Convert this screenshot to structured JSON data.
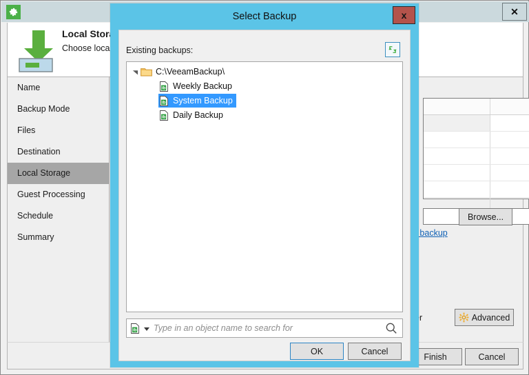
{
  "wizard": {
    "app_icon": "gear-icon",
    "close_label": "✕",
    "header": {
      "title": "Local Storage",
      "subtitle": "Choose locall",
      "icon": "down-arrow-icon"
    },
    "nav": {
      "items": [
        {
          "label": "Name",
          "selected": false
        },
        {
          "label": "Backup Mode",
          "selected": false
        },
        {
          "label": "Files",
          "selected": false
        },
        {
          "label": "Destination",
          "selected": false
        },
        {
          "label": "Local Storage",
          "selected": true
        },
        {
          "label": "Guest Processing",
          "selected": false
        },
        {
          "label": "Schedule",
          "selected": false
        },
        {
          "label": "Summary",
          "selected": false
        }
      ]
    },
    "content": {
      "refresh_icon": "refresh-icon",
      "browse_label": "Browse...",
      "map_backup_link": "p backup",
      "advanced_prefix_text": "er",
      "advanced_label": "Advanced",
      "advanced_icon": "gear-icon",
      "grid_rows": 7
    },
    "footer": {
      "finish_label": "Finish",
      "cancel_label": "Cancel"
    }
  },
  "dialog": {
    "title": "Select Backup",
    "close_label": "x",
    "existing_label": "Existing backups:",
    "refresh_icon": "refresh-icon",
    "tree": {
      "root": {
        "label": "C:\\VeeamBackup\\",
        "icon": "folder-icon",
        "expanded": true
      },
      "children": [
        {
          "label": "Weekly Backup",
          "icon": "backup-file-icon",
          "selected": false
        },
        {
          "label": "System Backup",
          "icon": "backup-file-icon",
          "selected": true
        },
        {
          "label": "Daily Backup",
          "icon": "backup-file-icon",
          "selected": false
        }
      ]
    },
    "search": {
      "placeholder": "Type in an object name to search for",
      "value": "",
      "type_icon": "backup-file-icon",
      "search_icon": "magnifier-icon"
    },
    "ok_label": "OK",
    "cancel_label": "Cancel"
  },
  "colors": {
    "dialog_border": "#5bc4e7",
    "selection": "#3399ff",
    "accent_green": "#4bb048",
    "close_red": "#b4534b",
    "link_blue": "#1061b5",
    "nav_selected": "#a6a6a6"
  }
}
